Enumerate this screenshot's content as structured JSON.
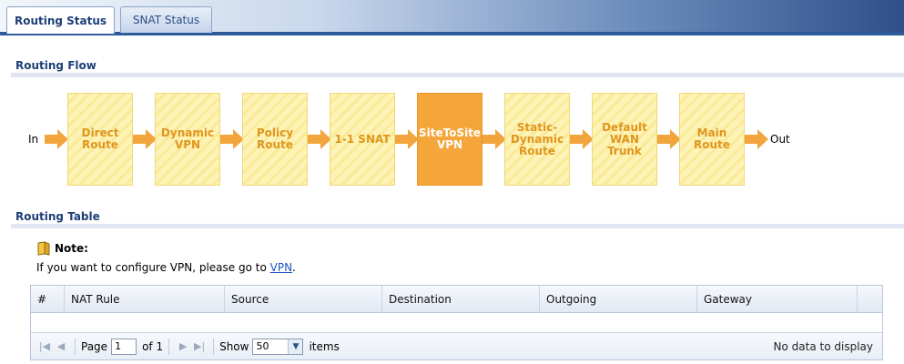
{
  "tabs": [
    {
      "label": "Routing Status",
      "active": true
    },
    {
      "label": "SNAT Status",
      "active": false
    }
  ],
  "routing_flow": {
    "title": "Routing Flow",
    "start_label": "In",
    "end_label": "Out",
    "steps": [
      {
        "label": "Direct Route",
        "active": false
      },
      {
        "label": "Dynamic VPN",
        "active": false
      },
      {
        "label": "Policy Route",
        "active": false
      },
      {
        "label": "1-1 SNAT",
        "active": false
      },
      {
        "label": "SiteToSite VPN",
        "active": true
      },
      {
        "label": "Static-Dynamic Route",
        "active": false
      },
      {
        "label": "Default WAN Trunk",
        "active": false
      },
      {
        "label": "Main Route",
        "active": false
      }
    ]
  },
  "routing_table": {
    "title": "Routing Table",
    "note_title": "Note:",
    "note_text": "If you want to configure VPN, please go to ",
    "note_link": "VPN",
    "note_end": ".",
    "columns": [
      "#",
      "NAT Rule",
      "Source",
      "Destination",
      "Outgoing",
      "Gateway"
    ],
    "rows": [],
    "pager": {
      "page_label": "Page",
      "page_value": "1",
      "of_label": "of 1",
      "show_label": "Show",
      "show_value": "50",
      "items_label": "items",
      "empty_text": "No data to display"
    }
  },
  "colors": {
    "accent": "#1d3f77",
    "flow_box": "#fdf3b6",
    "flow_active": "#f5a63a",
    "flow_text": "#e0961e",
    "arrow": "#f2a53c"
  }
}
